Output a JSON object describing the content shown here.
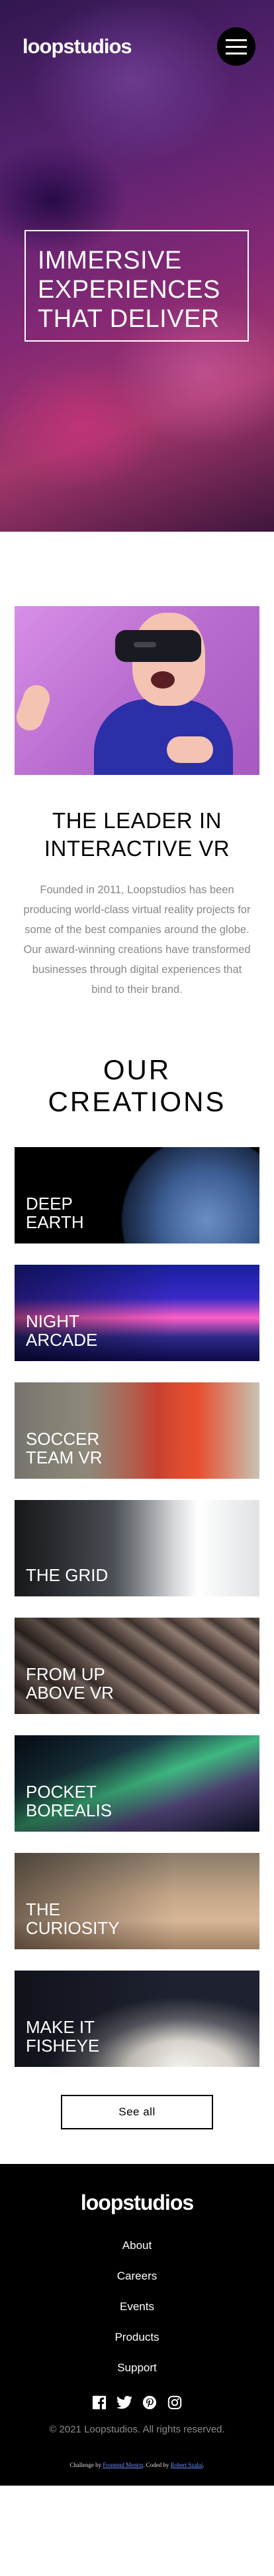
{
  "header": {
    "logo": "loopstudios",
    "menu_icon": "hamburger-menu-icon"
  },
  "hero": {
    "title": "Immersive experiences that deliver"
  },
  "about": {
    "title": "The leader in interactive VR",
    "text": "Founded in 2011, Loopstudios has been producing world-class virtual reality projects for some of the best companies around the globe. Our award-winning creations have transformed businesses through digital experiences that bind to their brand."
  },
  "creations": {
    "title": "Our creations",
    "items": [
      {
        "label": "Deep Earth"
      },
      {
        "label": "Night Arcade"
      },
      {
        "label": "Soccer Team VR"
      },
      {
        "label": "The Grid"
      },
      {
        "label": "From up above VR"
      },
      {
        "label": "Pocket Borealis"
      },
      {
        "label": "The Curiosity"
      },
      {
        "label": "Make it Fisheye"
      }
    ],
    "see_all": "See all"
  },
  "footer": {
    "logo": "loopstudios",
    "nav": [
      "About",
      "Careers",
      "Events",
      "Products",
      "Support"
    ],
    "social_icons": [
      "facebook-icon",
      "twitter-icon",
      "pinterest-icon",
      "instagram-icon"
    ],
    "copyright": "© 2021 Loopstudios. All rights reserved.",
    "attribution": {
      "challenge_prefix": "Challenge by",
      "challenge_link": "Frontend Mentor",
      "coded_prefix": ". Coded by",
      "coded_link": "Robert Szalai",
      "suffix": "."
    }
  },
  "colors": {
    "footer_bg": "#000000",
    "text_muted": "#888888",
    "link_blue": "#6d8cff"
  }
}
